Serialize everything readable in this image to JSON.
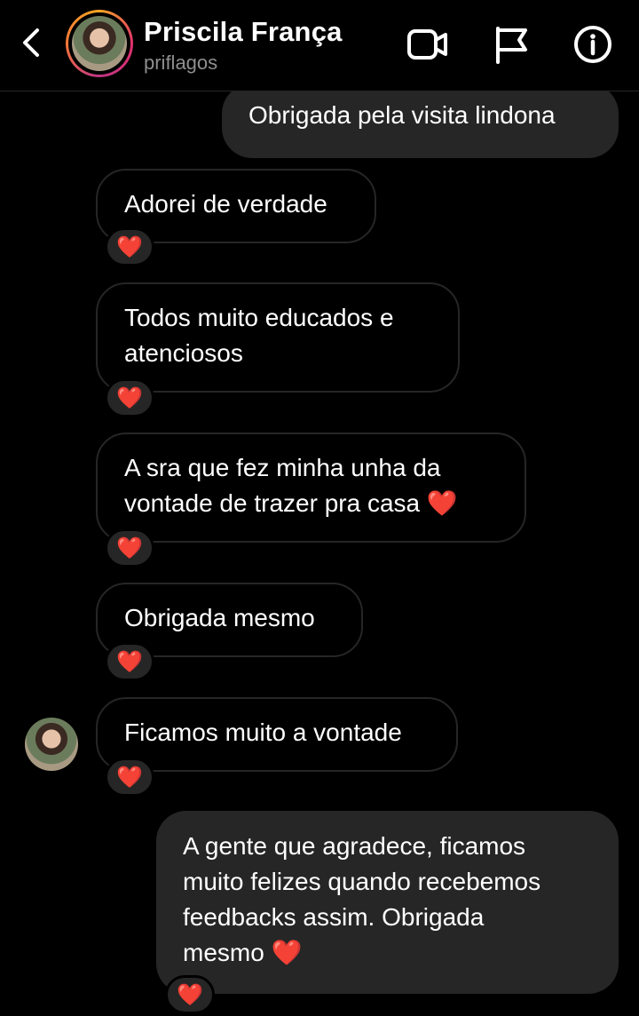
{
  "header": {
    "contact_name": "Priscila França",
    "username": "priflagos",
    "icons": [
      "back-chevron-icon",
      "video-call-icon",
      "report-flag-icon",
      "info-icon"
    ]
  },
  "messages": [
    {
      "direction": "sent",
      "text": "Obrigada pela visita lindona"
    },
    {
      "direction": "received",
      "text": "Adorei de verdade",
      "reaction": "❤️"
    },
    {
      "direction": "received",
      "text_lines": [
        "Todos muito educados e",
        "atenciosos"
      ],
      "reaction": "❤️"
    },
    {
      "direction": "received",
      "text_lines": [
        "A sra que fez minha unha da",
        "vontade de trazer pra casa"
      ],
      "emoji": "❤️",
      "reaction": "❤️"
    },
    {
      "direction": "received",
      "text": "Obrigada mesmo",
      "reaction": "❤️"
    },
    {
      "direction": "received",
      "text": "Ficamos muito a vontade",
      "reaction": "❤️"
    },
    {
      "direction": "sent",
      "text_lines": [
        "A gente que agradece, ficamos",
        "muito felizes quando recebemos",
        "feedbacks assim. Obrigada",
        "mesmo"
      ],
      "emoji": "❤️",
      "reaction": "❤️"
    }
  ],
  "colors": {
    "background": "#000000",
    "sent_bubble": "#262626",
    "received_border": "#262626",
    "secondary_text": "#8e8e8e",
    "heart": "#e0231c"
  }
}
